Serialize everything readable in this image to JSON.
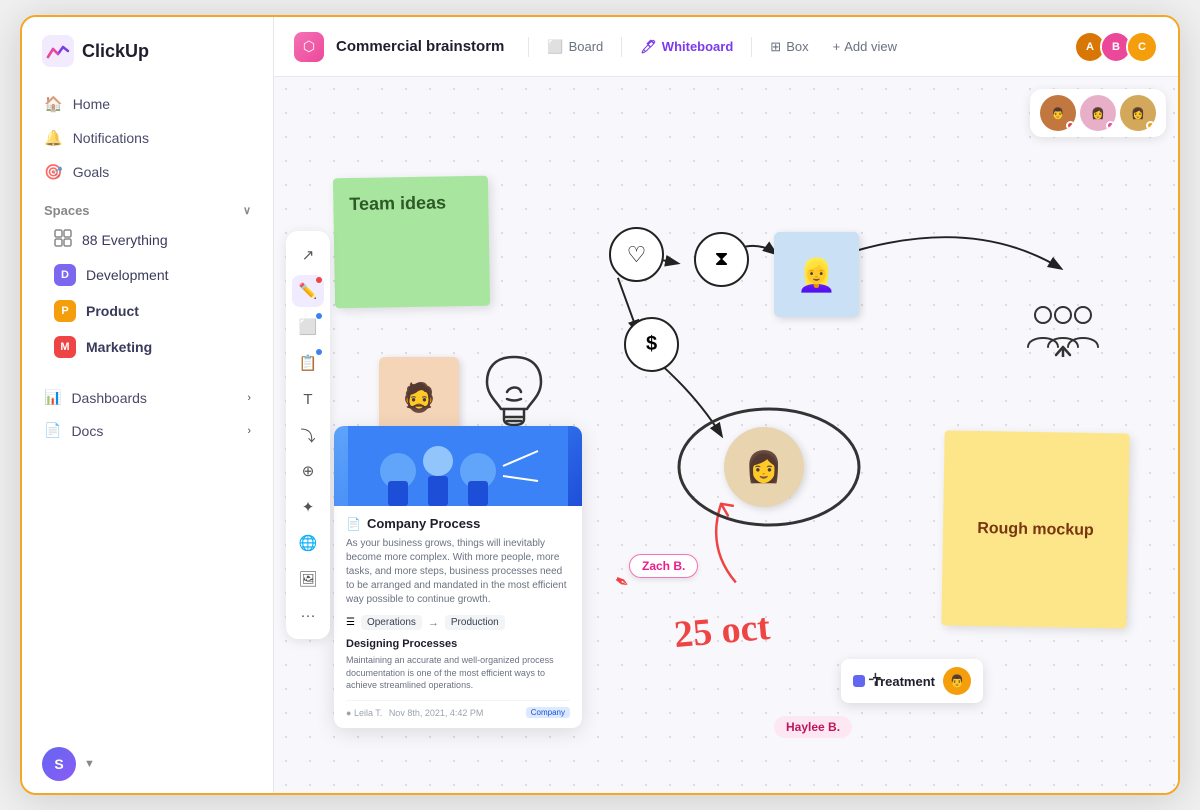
{
  "app": {
    "name": "ClickUp"
  },
  "sidebar": {
    "nav": [
      {
        "id": "home",
        "label": "Home",
        "icon": "🏠"
      },
      {
        "id": "notifications",
        "label": "Notifications",
        "icon": "🔔"
      },
      {
        "id": "goals",
        "label": "Goals",
        "icon": "🎯"
      }
    ],
    "spaces_label": "Spaces",
    "spaces": [
      {
        "id": "everything",
        "label": "88 Everything",
        "color": "none"
      },
      {
        "id": "development",
        "label": "Development",
        "initial": "D",
        "color": "#7b68ee"
      },
      {
        "id": "product",
        "label": "Product",
        "initial": "P",
        "color": "#f59e0b"
      },
      {
        "id": "marketing",
        "label": "Marketing",
        "initial": "M",
        "color": "#ef4444"
      }
    ],
    "bottom": [
      {
        "id": "dashboards",
        "label": "Dashboards"
      },
      {
        "id": "docs",
        "label": "Docs"
      }
    ]
  },
  "header": {
    "project_title": "Commercial brainstorm",
    "tabs": [
      {
        "id": "whiteboard",
        "label": "Whiteboard",
        "active": true
      },
      {
        "id": "board",
        "label": "Board",
        "active": false
      },
      {
        "id": "box",
        "label": "Box",
        "active": false
      }
    ],
    "add_view": "Add view"
  },
  "whiteboard": {
    "sticky_green": "Team ideas",
    "sticky_yellow": "Rough mockup",
    "process_card": {
      "title": "Company Process",
      "description": "As your business grows, things will inevitably become more complex. With more people, more tasks, and more steps, business processes need to be arranged and mandated in the most efficient way possible to continue growth.",
      "flow_from": "Operations",
      "flow_to": "Production",
      "sub_title": "Designing Processes",
      "sub_desc": "Maintaining an accurate and well-organized process documentation is one of the most efficient ways to achieve streamlined operations.",
      "author": "Leila T.",
      "date": "Nov 8th, 2021, 4:42 PM",
      "badge": "Company"
    },
    "label_zach": "Zach B.",
    "label_haylee": "Haylee B.",
    "date_annotation": "25 oct",
    "treatment_label": "Treatment",
    "persons_icon": "👥"
  }
}
